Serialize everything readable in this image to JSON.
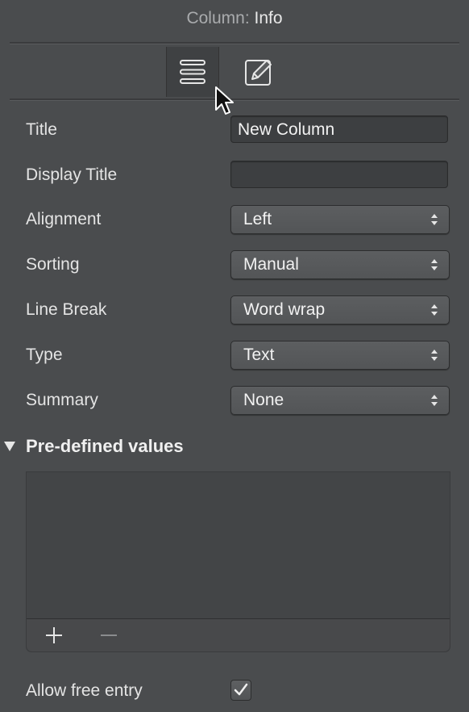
{
  "header": {
    "prefix": "Column:",
    "title": "Info"
  },
  "toolbar": {
    "tabs": [
      {
        "icon": "list-lines-icon",
        "active": true
      },
      {
        "icon": "pencil-edit-icon",
        "active": false
      }
    ]
  },
  "fields": {
    "title": {
      "label": "Title",
      "value": "New Column"
    },
    "display_title": {
      "label": "Display Title",
      "value": ""
    },
    "alignment": {
      "label": "Alignment",
      "value": "Left"
    },
    "sorting": {
      "label": "Sorting",
      "value": "Manual"
    },
    "line_break": {
      "label": "Line Break",
      "value": "Word wrap"
    },
    "type": {
      "label": "Type",
      "value": "Text"
    },
    "summary": {
      "label": "Summary",
      "value": "None"
    }
  },
  "predefined": {
    "title": "Pre-defined values",
    "items": [],
    "add_icon": "plus-icon",
    "remove_icon": "minus-icon"
  },
  "free_entry": {
    "label": "Allow free entry",
    "checked": true
  },
  "colors": {
    "background": "#4a4c4e",
    "text": "#e4e4e4",
    "field": "#3d3f41"
  }
}
